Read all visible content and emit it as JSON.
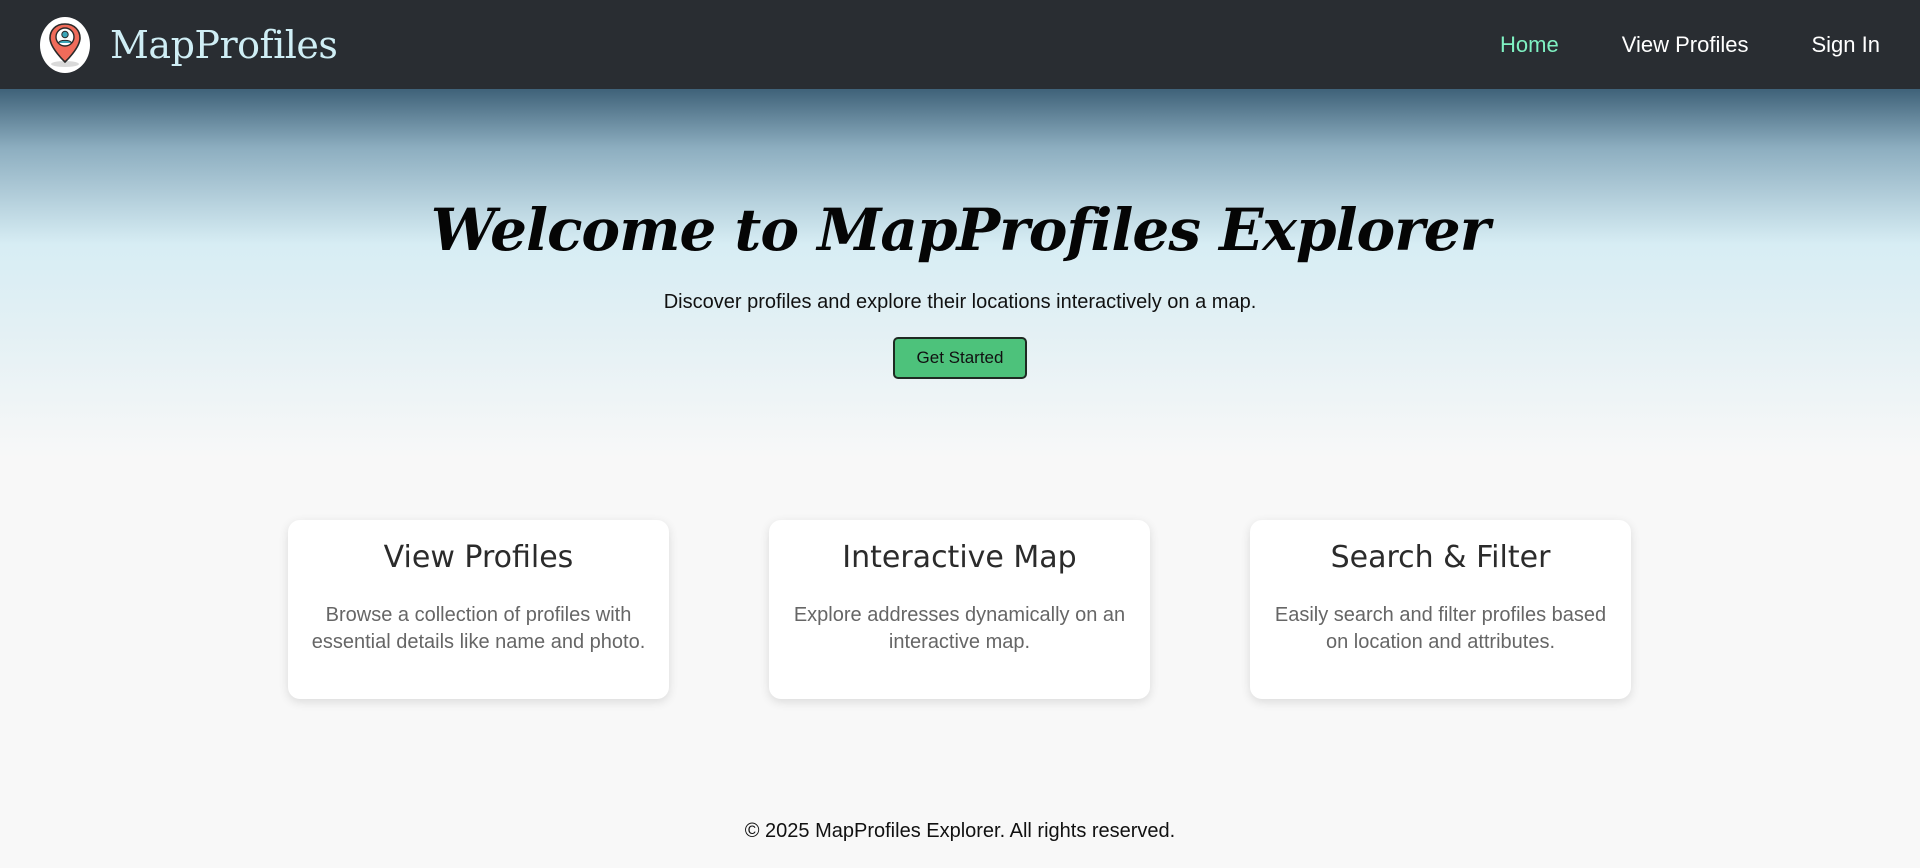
{
  "navbar": {
    "brand": "MapProfiles",
    "logo_icon": "profile-map-pin-icon",
    "links": [
      {
        "label": "Home",
        "active": true
      },
      {
        "label": "View Profiles",
        "active": false
      },
      {
        "label": "Sign In",
        "active": false
      }
    ],
    "active_color": "#7ff1c2"
  },
  "hero": {
    "title": "Welcome to MapProfiles Explorer",
    "subtitle": "Discover profiles and explore their locations interactively on a map.",
    "cta_label": "Get Started",
    "cta_color": "#4dc27b"
  },
  "features": [
    {
      "title": "View Profiles",
      "description": "Browse a collection of profiles with essential details like name and photo."
    },
    {
      "title": "Interactive Map",
      "description": "Explore addresses dynamically on an interactive map."
    },
    {
      "title": "Search & Filter",
      "description": "Easily search and filter profiles based on location and attributes."
    }
  ],
  "footer": {
    "text": "© 2025 MapProfiles Explorer. All rights reserved."
  }
}
